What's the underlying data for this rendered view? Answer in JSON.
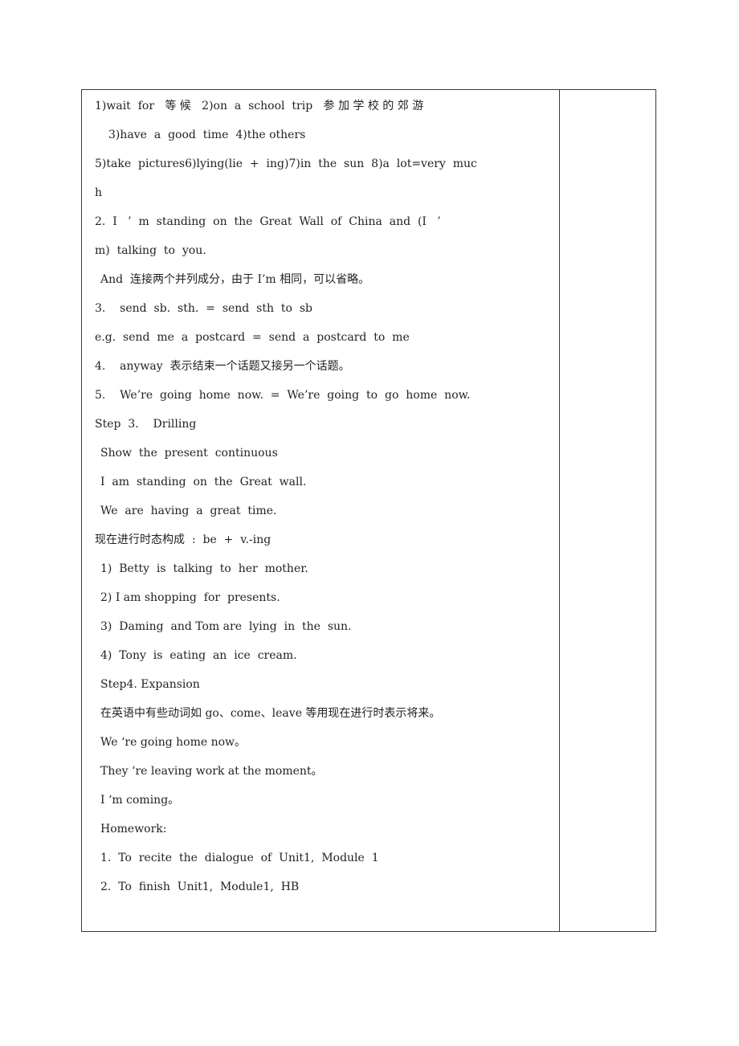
{
  "document": {
    "lines": [
      "1)wait  for   等 候   2)on  a  school  trip   参 加 学 校 的 郊 游",
      "3)have  a  good  time  4)the others",
      "5)take  pictures6)lying(lie  +  ing)7)in  the  sun  8)a  lot=very  muc",
      "h",
      "2.  I   ’  m  standing  on  the  Great  Wall  of  China  and  (I   ’",
      "m)  talking  to  you.",
      "And  连接两个并列成分，由于 I’m 相同，可以省略。",
      "3.    send  sb.  sth.  =  send  sth  to  sb",
      "e.g.  send  me  a  postcard  =  send  a  postcard  to  me",
      "4.    anyway  表示结束一个话题又接另一个话题。",
      "5.    We’re  going  home  now.  =  We’re  going  to  go  home  now.",
      "Step  3.    Drilling",
      "Show  the  present  continuous",
      "I  am  standing  on  the  Great  wall.",
      "We  are  having  a  great  time.",
      "现在进行时态构成  :  be  +  v.-ing",
      "1)  Betty  is  talking  to  her  mother.",
      "2) I am shopping  for  presents.",
      "3)  Daming  and Tom are  lying  in  the  sun.",
      "4)  Tony  is  eating  an  ice  cream.",
      "Step4. Expansion",
      "在英语中有些动词如 go、come、leave 等用现在进行时表示将来。",
      "We ‘re going home now。",
      "They ‘re leaving work at the moment。",
      "I ‘m coming。",
      "Homework:",
      "1.  To  recite  the  dialogue  of  Unit1,  Module  1",
      "2.  To  finish  Unit1,  Module1,  HB"
    ]
  }
}
